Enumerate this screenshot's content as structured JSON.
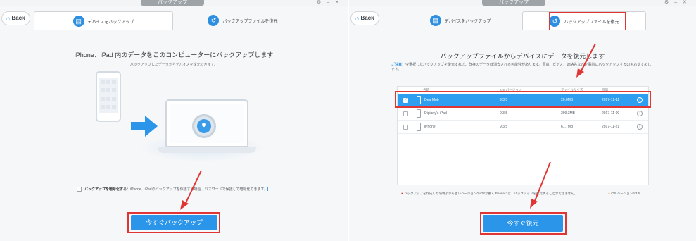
{
  "app": {
    "window_title": "バックアップ"
  },
  "left": {
    "back_label": "Back",
    "tabs": [
      {
        "label": "デバイスをバックアップ",
        "icon": "device-backup-icon",
        "active": true
      },
      {
        "label": "バックアップファイルを復元",
        "icon": "restore-icon",
        "active": false
      }
    ],
    "title": "iPhone、iPad 内のデータをこのコンピューターにバックアップします",
    "subtitle": "バックアップしたデータからデバイスを復元できます。",
    "encrypt_label": "バックアップを暗号化する：",
    "encrypt_desc": "iPhone、iPadのバックアップを保護する場合、パスワードで保護して暗号化できます。",
    "encrypt_info": "!",
    "backup_button": "今すぐバックアップ"
  },
  "right": {
    "back_label": "Back",
    "tabs": [
      {
        "label": "デバイスをバックアップ",
        "icon": "device-backup-icon",
        "active": false
      },
      {
        "label": "バックアップファイルを復元",
        "icon": "restore-icon",
        "active": true
      }
    ],
    "title": "バックアップファイルからデバイスにデータを復元します",
    "hint_label": "ご注意：",
    "hint_text": "今選択したバックアップを復元すれば、既存のデータは消去される可能性があります。写真、ビデオ、連絡先などを事前にバックアップするのをおすすめします。",
    "table": {
      "columns": [
        "名前",
        "iOS バージョン",
        "ファイルサイズ",
        "時間"
      ],
      "rows": [
        {
          "name": "DearMob",
          "ios": "9.3.5",
          "size": "26.0MB",
          "time": "2017-12-11",
          "selected": true
        },
        {
          "name": "Digiarty's iPad",
          "ios": "9.3.5",
          "size": "299.3MB",
          "time": "2017-11-09",
          "selected": false
        },
        {
          "name": "iPhone",
          "ios": "9.3.5",
          "size": "61.7MB",
          "time": "2017-11-21",
          "selected": false
        }
      ]
    },
    "note": "バックアップを作成した環境よりも古いバージョンのiOSが動くiPhoneには、バックアップを復元することができません。",
    "ios_version": "iOS バージョン9.3.5",
    "restore_button": "今すぐ復元"
  },
  "colors": {
    "accent": "#2b95e9",
    "highlight_border": "#e03535",
    "selected_row": "#2e9ff0"
  }
}
